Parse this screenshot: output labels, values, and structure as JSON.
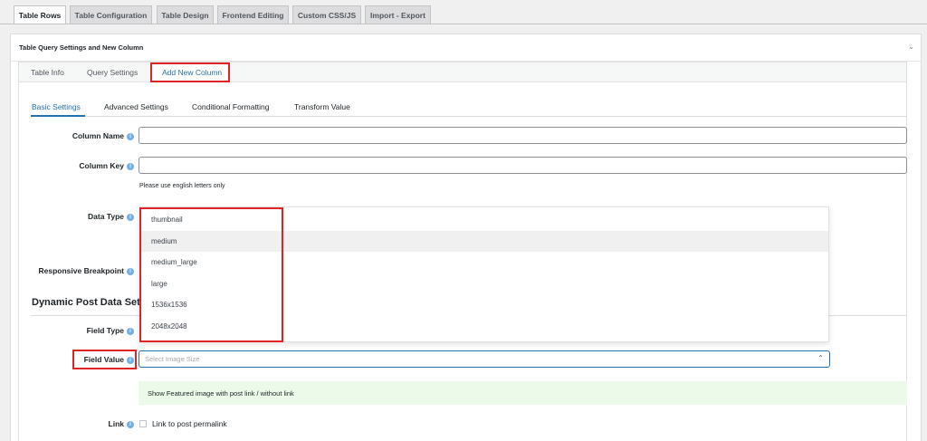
{
  "top_tabs": [
    {
      "label": "Table Rows",
      "active": true
    },
    {
      "label": "Table Configuration"
    },
    {
      "label": "Table Design"
    },
    {
      "label": "Frontend Editing"
    },
    {
      "label": "Custom CSS/JS"
    },
    {
      "label": "Import - Export"
    }
  ],
  "panel": {
    "title": "Table Query Settings and New Column"
  },
  "inner_tabs": [
    {
      "label": "Table Info"
    },
    {
      "label": "Query Settings"
    },
    {
      "label": "Add New Column",
      "active": true
    }
  ],
  "sub_tabs": [
    {
      "label": "Basic Settings",
      "active": true
    },
    {
      "label": "Advanced Settings"
    },
    {
      "label": "Conditional Formatting"
    },
    {
      "label": "Transform Value"
    }
  ],
  "form": {
    "column_name_label": "Column Name",
    "column_name_value": "",
    "column_key_label": "Column Key",
    "column_key_value": "",
    "column_key_hint": "Please use english letters only",
    "data_type_label": "Data Type",
    "responsive_label": "Responsive Breakpoint",
    "section_heading": "Dynamic Post Data Setti",
    "field_type_label": "Field Type",
    "field_value_label": "Field Value",
    "field_value_placeholder": "Select Image Size",
    "notice": "Show Featured image with post link / without link",
    "link_label": "Link",
    "link_checkbox_label": "Link to to post permalink"
  },
  "dropdown_options": [
    "thumbnail",
    "medium",
    "medium_large",
    "large",
    "1536x1536",
    "2048x2048"
  ],
  "highlighted_option": "medium",
  "colors": {
    "accent": "#2271b1",
    "highlight_box": "#e02424",
    "notice_bg": "#ecfae9",
    "info_icon": "#72aee6"
  }
}
